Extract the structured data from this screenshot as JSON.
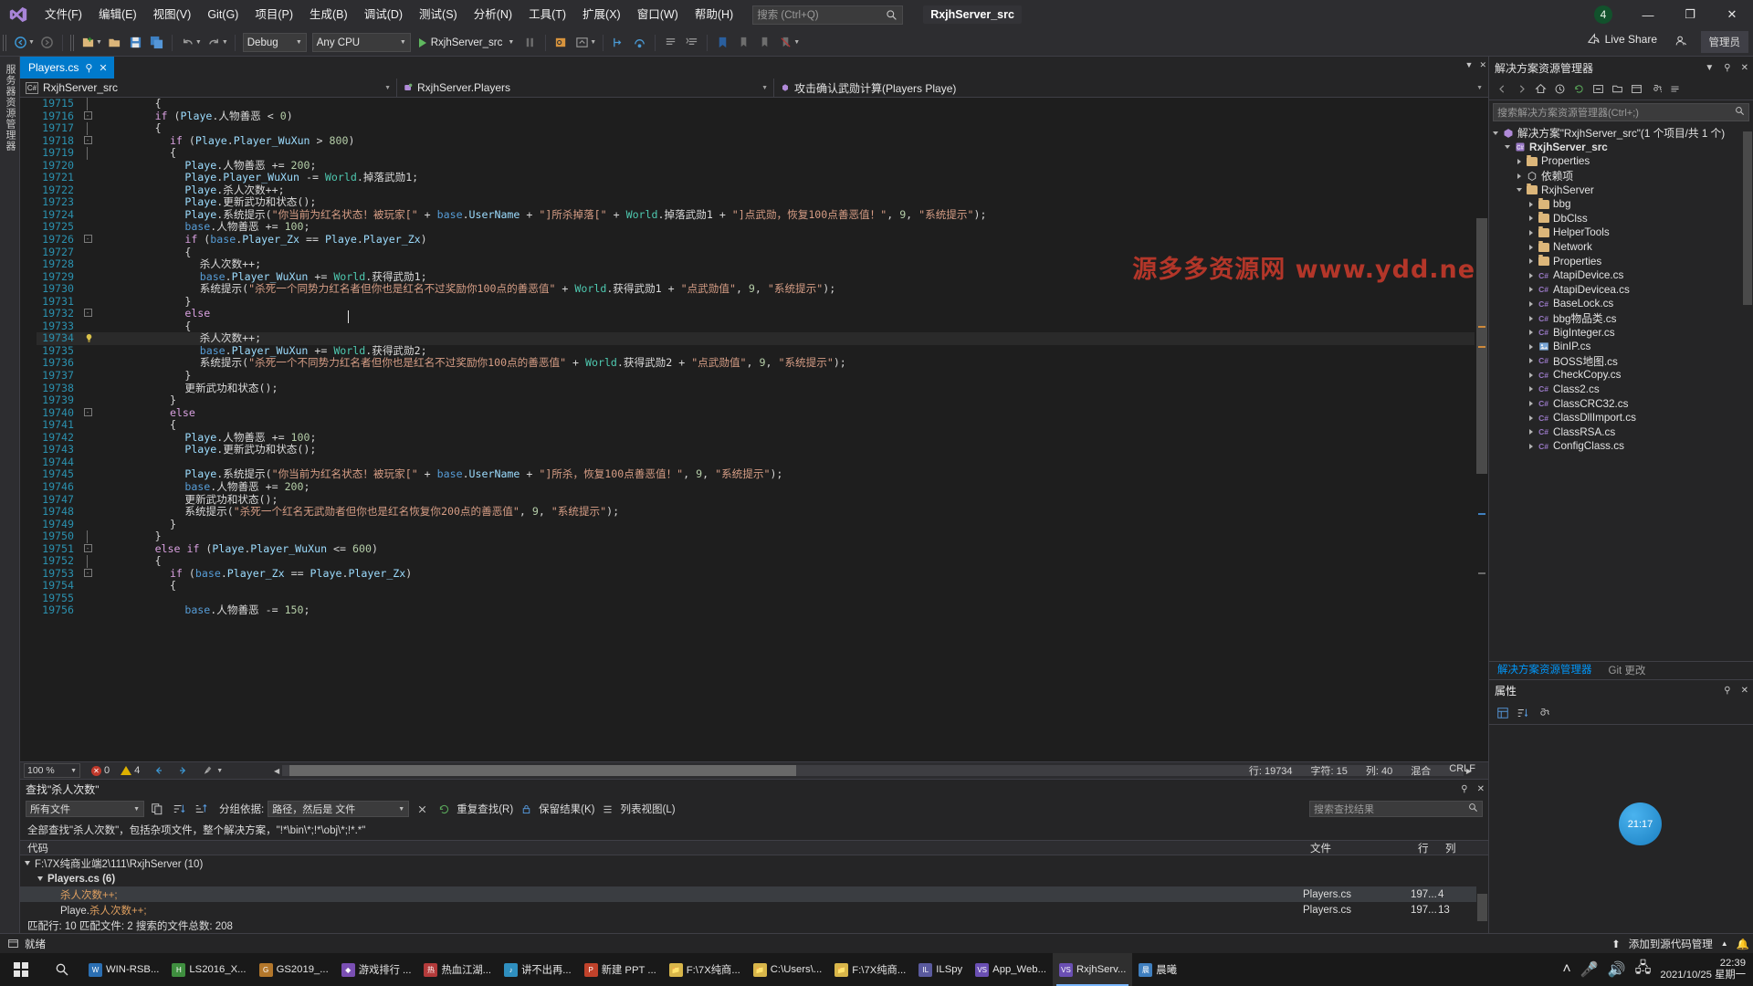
{
  "titlebar": {
    "menus": [
      "文件(F)",
      "编辑(E)",
      "视图(V)",
      "Git(G)",
      "项目(P)",
      "生成(B)",
      "调试(D)",
      "测试(S)",
      "分析(N)",
      "工具(T)",
      "扩展(X)",
      "窗口(W)",
      "帮助(H)"
    ],
    "search_placeholder": "搜索 (Ctrl+Q)",
    "project_chip": "RxjhServer_src",
    "notification_count": "4",
    "minimize": "—",
    "maximize": "❐",
    "close": "✕"
  },
  "toolbar": {
    "config": "Debug",
    "platform": "Any CPU",
    "run_target": "RxjhServer_src",
    "live_share": "Live Share",
    "admin": "管理员"
  },
  "leftrail": {
    "label": "服务器资源管理器"
  },
  "editor": {
    "tab": "Players.cs",
    "tab_pin": "⚲",
    "tab_close": "✕",
    "breadcrumb_project": "RxjhServer_src",
    "breadcrumb_class": "RxjhServer.Players",
    "breadcrumb_member": "攻击确认武勋计算(Players Playe)",
    "watermark": "源多多资源网 www.ydd.net",
    "zoom": "100 %",
    "errors": "0",
    "warnings": "4",
    "line_label": "行: 19734",
    "char_label": "字符: 15",
    "col_label": "列: 40",
    "mix_label": "混合",
    "eol_label": "CRLF",
    "lines": [
      {
        "n": "19715",
        "fold": "|",
        "ind": 4,
        "t": "{"
      },
      {
        "n": "19716",
        "fold": "-",
        "ind": 4,
        "t": "if (Playe.人物善恶 < 0)"
      },
      {
        "n": "19717",
        "fold": "|",
        "ind": 4,
        "t": "{"
      },
      {
        "n": "19718",
        "fold": "-",
        "ind": 5,
        "t": "if (Playe.Player_WuXun > 800)"
      },
      {
        "n": "19719",
        "fold": "|",
        "ind": 5,
        "t": "{"
      },
      {
        "n": "19720",
        "fold": "",
        "ind": 6,
        "t": "Playe.人物善恶 += 200;"
      },
      {
        "n": "19721",
        "fold": "",
        "ind": 6,
        "t": "Playe.Player_WuXun -= World.掉落武勋1;"
      },
      {
        "n": "19722",
        "fold": "",
        "ind": 6,
        "t": "Playe.杀人次数++;"
      },
      {
        "n": "19723",
        "fold": "",
        "ind": 6,
        "t": "Playe.更新武功和状态();"
      },
      {
        "n": "19724",
        "fold": "",
        "ind": 6,
        "t": "Playe.系统提示(\"你当前为红名状态！被玩家[\" + base.UserName + \"]所杀掉落[\" + World.掉落武勋1 + \"]点武勋，恢复100点善恶值！\", 9, \"系统提示\");"
      },
      {
        "n": "19725",
        "fold": "",
        "ind": 6,
        "t": "base.人物善恶 += 100;"
      },
      {
        "n": "19726",
        "fold": "-",
        "ind": 6,
        "t": "if (base.Player_Zx == Playe.Player_Zx)"
      },
      {
        "n": "19727",
        "fold": "",
        "ind": 6,
        "t": "{"
      },
      {
        "n": "19728",
        "fold": "",
        "ind": 7,
        "t": "杀人次数++;"
      },
      {
        "n": "19729",
        "fold": "",
        "ind": 7,
        "t": "base.Player_WuXun += World.获得武勋1;"
      },
      {
        "n": "19730",
        "fold": "",
        "ind": 7,
        "t": "系统提示(\"杀死一个同势力红名者但你也是红名不过奖励你100点的善恶值\" + World.获得武勋1 + \"点武勋值\", 9, \"系统提示\");"
      },
      {
        "n": "19731",
        "fold": "",
        "ind": 6,
        "t": "}"
      },
      {
        "n": "19732",
        "fold": "-",
        "ind": 6,
        "t": "else"
      },
      {
        "n": "19733",
        "fold": "",
        "ind": 6,
        "t": "{"
      },
      {
        "n": "19734",
        "fold": "",
        "ind": 7,
        "t": "杀人次数++;",
        "current": true,
        "bulb": true
      },
      {
        "n": "19735",
        "fold": "",
        "ind": 7,
        "t": "base.Player_WuXun += World.获得武勋2;"
      },
      {
        "n": "19736",
        "fold": "",
        "ind": 7,
        "t": "系统提示(\"杀死一个不同势力红名者但你也是红名不过奖励你100点的善恶值\" + World.获得武勋2 + \"点武勋值\", 9, \"系统提示\");"
      },
      {
        "n": "19737",
        "fold": "",
        "ind": 6,
        "t": "}"
      },
      {
        "n": "19738",
        "fold": "",
        "ind": 6,
        "t": "更新武功和状态();"
      },
      {
        "n": "19739",
        "fold": "",
        "ind": 5,
        "t": "}"
      },
      {
        "n": "19740",
        "fold": "-",
        "ind": 5,
        "t": "else"
      },
      {
        "n": "19741",
        "fold": "",
        "ind": 5,
        "t": "{"
      },
      {
        "n": "19742",
        "fold": "",
        "ind": 6,
        "t": "Playe.人物善恶 += 100;"
      },
      {
        "n": "19743",
        "fold": "",
        "ind": 6,
        "t": "Playe.更新武功和状态();"
      },
      {
        "n": "19744",
        "fold": "",
        "ind": 6,
        "t": ""
      },
      {
        "n": "19745",
        "fold": "",
        "ind": 6,
        "t": "Playe.系统提示(\"你当前为红名状态！被玩家[\" + base.UserName + \"]所杀，恢复100点善恶值！\", 9, \"系统提示\");"
      },
      {
        "n": "19746",
        "fold": "",
        "ind": 6,
        "t": "base.人物善恶 += 200;"
      },
      {
        "n": "19747",
        "fold": "",
        "ind": 6,
        "t": "更新武功和状态();"
      },
      {
        "n": "19748",
        "fold": "",
        "ind": 6,
        "t": "系统提示(\"杀死一个红名无武勋者但你也是红名恢复你200点的善恶值\", 9, \"系统提示\");"
      },
      {
        "n": "19749",
        "fold": "",
        "ind": 5,
        "t": "}"
      },
      {
        "n": "19750",
        "fold": "|",
        "ind": 4,
        "t": "}"
      },
      {
        "n": "19751",
        "fold": "-",
        "ind": 4,
        "t": "else if (Playe.Player_WuXun <= 600)"
      },
      {
        "n": "19752",
        "fold": "|",
        "ind": 4,
        "t": "{"
      },
      {
        "n": "19753",
        "fold": "-",
        "ind": 5,
        "t": "if (base.Player_Zx == Playe.Player_Zx)"
      },
      {
        "n": "19754",
        "fold": "",
        "ind": 5,
        "t": "{"
      },
      {
        "n": "19755",
        "fold": "",
        "ind": 5,
        "t": ""
      },
      {
        "n": "19756",
        "fold": "",
        "ind": 6,
        "t": "base.人物善恶 -= 150;"
      }
    ]
  },
  "findresults": {
    "title": "查找\"杀人次数\"",
    "scope": "所有文件",
    "groupby_label": "分组依据:",
    "groupby_value": "路径，然后是 文件",
    "repeat_search": "重复查找(R)",
    "keep_results": "保留结果(K)",
    "list_view": "列表视图(L)",
    "search_placeholder": "搜索查找结果",
    "code_header": "代码",
    "file_header": "文件",
    "line_header": "行",
    "col_header": "列",
    "description": "全部查找\"杀人次数\"，包括杂项文件，整个解决方案，\"!*\\bin\\*;!*\\obj\\*;!*.*\"",
    "group_path": "F:\\7X纯商业端2\\111\\RxjhServer (10)",
    "group_file": "Players.cs (6)",
    "rows": [
      {
        "code": "杀人次数++;",
        "code_pre": "",
        "file": "Players.cs",
        "line": "197...",
        "col": "4",
        "selected": true
      },
      {
        "code": "杀人次数++;",
        "code_pre": "Playe.",
        "file": "Players.cs",
        "line": "197...",
        "col": "13",
        "selected": false
      }
    ],
    "summary": "匹配行: 10 匹配文件: 2 搜索的文件总数: 208"
  },
  "solution": {
    "title": "解决方案资源管理器",
    "search_placeholder": "搜索解决方案资源管理器(Ctrl+;)",
    "root": "解决方案\"RxjhServer_src\"(1 个项目/共 1 个)",
    "project": "RxjhServer_src",
    "tabs": [
      {
        "label": "解决方案资源管理器",
        "active": true
      },
      {
        "label": "Git 更改",
        "active": false
      }
    ],
    "nodes": [
      {
        "label": "Properties",
        "depth": 1,
        "icon": "folder",
        "arrow": "r"
      },
      {
        "label": "依赖项",
        "depth": 1,
        "icon": "deps",
        "arrow": "r"
      },
      {
        "label": "RxjhServer",
        "depth": 1,
        "icon": "folder",
        "arrow": "d"
      },
      {
        "label": "bbg",
        "depth": 2,
        "icon": "folder",
        "arrow": "r"
      },
      {
        "label": "DbClss",
        "depth": 2,
        "icon": "folder",
        "arrow": "r"
      },
      {
        "label": "HelperTools",
        "depth": 2,
        "icon": "folder",
        "arrow": "r"
      },
      {
        "label": "Network",
        "depth": 2,
        "icon": "folder",
        "arrow": "r"
      },
      {
        "label": "Properties",
        "depth": 2,
        "icon": "folder",
        "arrow": "r"
      },
      {
        "label": "AtapiDevice.cs",
        "depth": 2,
        "icon": "cs",
        "arrow": "r"
      },
      {
        "label": "AtapiDevicea.cs",
        "depth": 2,
        "icon": "cs",
        "arrow": "r"
      },
      {
        "label": "BaseLock.cs",
        "depth": 2,
        "icon": "cs",
        "arrow": "r"
      },
      {
        "label": "bbg物品类.cs",
        "depth": 2,
        "icon": "cs",
        "arrow": "r"
      },
      {
        "label": "BigInteger.cs",
        "depth": 2,
        "icon": "cs",
        "arrow": "r"
      },
      {
        "label": "BinIP.cs",
        "depth": 2,
        "icon": "img",
        "arrow": "r"
      },
      {
        "label": "BOSS地图.cs",
        "depth": 2,
        "icon": "cs",
        "arrow": "r"
      },
      {
        "label": "CheckCopy.cs",
        "depth": 2,
        "icon": "cs",
        "arrow": "r"
      },
      {
        "label": "Class2.cs",
        "depth": 2,
        "icon": "cs",
        "arrow": "r"
      },
      {
        "label": "ClassCRC32.cs",
        "depth": 2,
        "icon": "cs",
        "arrow": "r"
      },
      {
        "label": "ClassDllImport.cs",
        "depth": 2,
        "icon": "cs",
        "arrow": "r"
      },
      {
        "label": "ClassRSA.cs",
        "depth": 2,
        "icon": "cs",
        "arrow": "r"
      },
      {
        "label": "ConfigClass.cs",
        "depth": 2,
        "icon": "cs",
        "arrow": "r"
      }
    ]
  },
  "properties": {
    "title": "属性",
    "clock": "21:17"
  },
  "vsstatus": {
    "ready": "就绪",
    "source_control": "添加到源代码管理"
  },
  "taskbar": {
    "apps": [
      {
        "label": "WIN-RSB...",
        "color": "#2b6fb3",
        "glyph": "W",
        "active": false
      },
      {
        "label": "LS2016_X...",
        "color": "#3f8f3f",
        "glyph": "H",
        "active": false
      },
      {
        "label": "GS2019_...",
        "color": "#b3772b",
        "glyph": "G",
        "active": false
      },
      {
        "label": "游戏排行 ...",
        "color": "#7a4fb3",
        "glyph": "◆",
        "active": false
      },
      {
        "label": "热血江湖...",
        "color": "#b33b3b",
        "glyph": "热",
        "active": false
      },
      {
        "label": "讲不出再...",
        "color": "#2f8fbf",
        "glyph": "♪",
        "active": false
      },
      {
        "label": "新建 PPT ...",
        "color": "#c0422b",
        "glyph": "P",
        "active": false
      },
      {
        "label": "F:\\7X纯商...",
        "color": "#d8b64a",
        "glyph": "📁",
        "active": false
      },
      {
        "label": "C:\\Users\\...",
        "color": "#d8b64a",
        "glyph": "📁",
        "active": false
      },
      {
        "label": "F:\\7X纯商...",
        "color": "#d8b64a",
        "glyph": "📁",
        "active": false
      },
      {
        "label": "ILSpy",
        "color": "#5a5a9e",
        "glyph": "IL",
        "active": false
      },
      {
        "label": "App_Web...",
        "color": "#6a4fb3",
        "glyph": "VS",
        "active": false
      },
      {
        "label": "RxjhServ...",
        "color": "#6a4fb3",
        "glyph": "VS",
        "active": true
      },
      {
        "label": "晨曦",
        "color": "#3f7fbf",
        "glyph": "晨",
        "active": false
      }
    ],
    "time": "22:39",
    "date": "2021/10/25 星期一"
  }
}
